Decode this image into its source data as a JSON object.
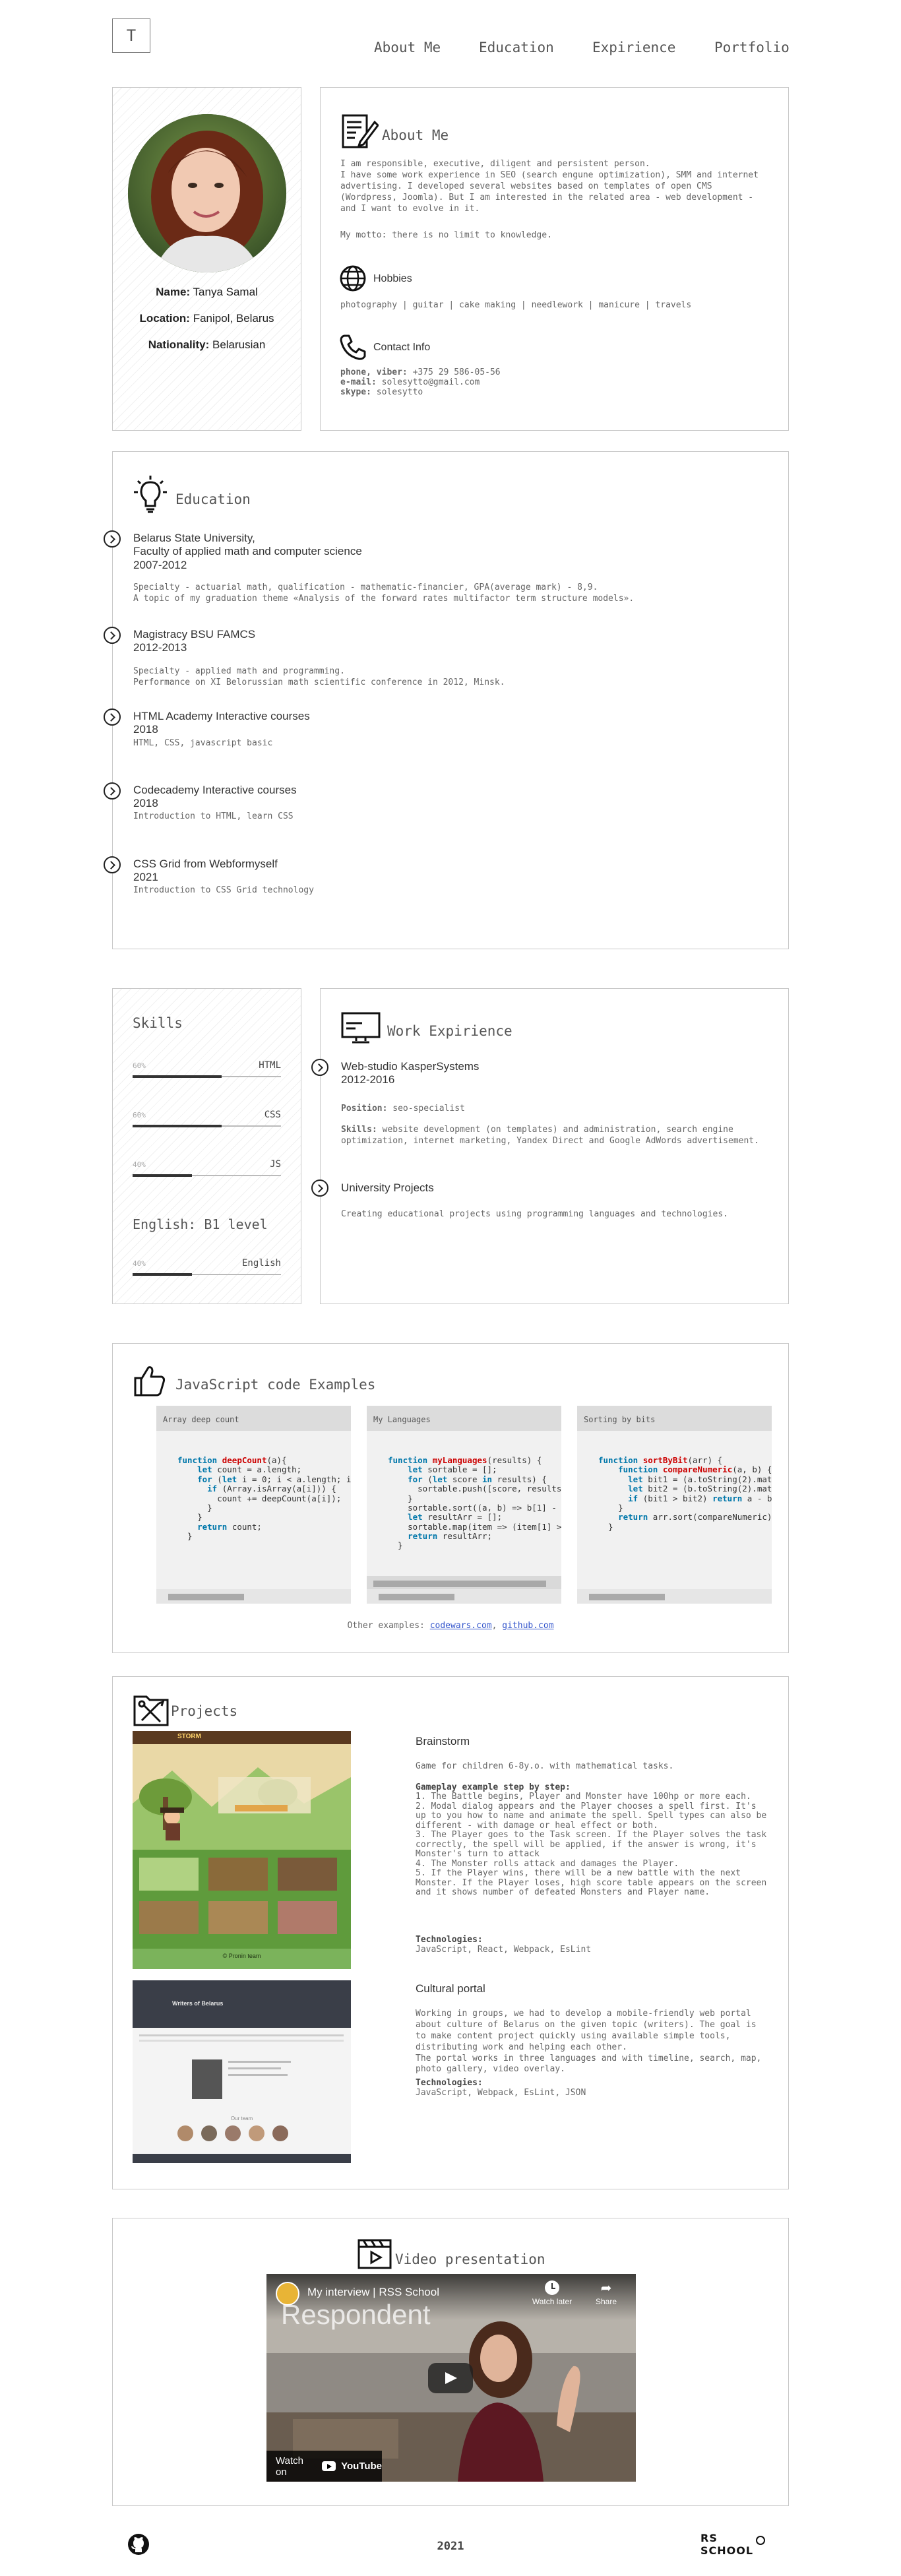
{
  "header": {
    "logo_letter": "T",
    "nav": [
      "About Me",
      "Education",
      "Expirience",
      "Portfolio"
    ]
  },
  "profile": {
    "photo_alt": "Tanya Samal portrait",
    "name_label": "Name:",
    "name_value": "Tanya Samal",
    "location_label": "Location:",
    "location_value": "Fanipol, Belarus",
    "nationality_label": "Nationality:",
    "nationality_value": "Belarusian"
  },
  "about": {
    "title": "About Me",
    "text": "I am responsible, executive, diligent and persistent person.\nI have some work experience in SEO (search engune optimization), SMM and internet advertising. I developed several websites based on templates of open CMS (Wordpress, Joomla). But I am interested in the related area - web development - and I want to evolve in it.",
    "motto": "My motto: there is no limit to knowledge.",
    "hobbies_title": "Hobbies",
    "hobbies": "photography | guitar | cake making | needlework | manicure | travels",
    "contact_title": "Contact Info",
    "phone_label": "phone, viber:",
    "phone_value": "+375 29 586-05-56",
    "email_label": "e-mail:",
    "email_value": "solesytto@gmail.com",
    "skype_label": "skype:",
    "skype_value": "solesytto"
  },
  "education": {
    "title": "Education",
    "items": [
      {
        "heading": "Belarus State University,\nFaculty of applied math and computer science\n2007-2012",
        "text": "Specialty - actuarial math, qualification - mathematic-financier, GPA(average mark) - 8,9.\nA topic of my graduation theme «Analysis of the forward rates multifactor term structure models»."
      },
      {
        "heading": "Magistracy BSU FAMCS\n2012-2013",
        "text": "Specialty - applied math and programming.\nPerformance on XI Belorussian math scientific conference in 2012, Minsk."
      },
      {
        "heading": "HTML Academy Interactive courses\n2018",
        "text": "HTML, CSS, javascript basic"
      },
      {
        "heading": "Codecademy Interactive courses\n2018",
        "text": "Introduction to HTML, learn CSS"
      },
      {
        "heading": "CSS Grid from Webformyself\n2021",
        "text": "Introduction to CSS Grid technology"
      }
    ]
  },
  "skills": {
    "title": "Skills",
    "items": [
      {
        "pct_label": "60%",
        "name": "HTML",
        "level": 0.6
      },
      {
        "pct_label": "60%",
        "name": "CSS",
        "level": 0.6
      },
      {
        "pct_label": "40%",
        "name": "JS",
        "level": 0.4
      }
    ],
    "english_title": "English: B1 level",
    "english": {
      "pct_label": "40%",
      "name": "English",
      "level": 0.4
    }
  },
  "work": {
    "title": "Work Expirience",
    "items": [
      {
        "heading": "Web-studio KasperSystems\n2012-2016",
        "position_label": "Position:",
        "position": "seo-specialist",
        "skills_label": "Skills:",
        "skills": "website development (on templates) and administration, search engine optimization, internet marketing, Yandex Direct and Google AdWords advertisement."
      },
      {
        "heading": "University Projects",
        "text": "Creating educational projects using programming languages and technologies."
      }
    ]
  },
  "code": {
    "title": "JavaScript code Examples",
    "cards": [
      {
        "title": "Array deep count"
      },
      {
        "title": "My Languages"
      },
      {
        "title": "Sorting by bits"
      }
    ],
    "other_label": "Other examples:",
    "link1": "codewars.com",
    "link2": "github.com"
  },
  "projects": {
    "title": "Projects",
    "items": [
      {
        "name": "Brainstorm",
        "intro": "Game for children 6-8y.o. with mathematical tasks.",
        "steps_title": "Gameplay example step by step:",
        "steps": "1. The Battle begins, Player and Monster have 100hp or more each.\n2. Modal dialog appears and the Player chooses a spell first. It's up to you how to name and animate the spell. Spell types can also be different - with damage or heal effect or both.\n3. The Player goes to the Task screen. If the Player solves the task correctly, the spell will be applied, if the answer is wrong, it's Monster's turn to attack\n4. The Monster rolls attack and damages the Player.\n5. If the Player wins, there will be a new battle with the next Monster. If the Player loses, high score table appears on the screen and it shows number of defeated Monsters and Player name.",
        "tech_title": "Technologies:",
        "tech": "JavaScript, React, Webpack, EsLint",
        "shot_brand": "STORM",
        "shot_footer": "© Pronin team"
      },
      {
        "name": "Cultural portal",
        "intro": "Working in groups, we had to develop a mobile-friendly web portal about culture of Belarus on the given topic (writers). The goal is to make content project quickly using available simple tools, distributing work and helping each other.\nThe portal works in three languages and with timeline, search, map, photo gallery, video overlay.",
        "tech_title": "Technologies:",
        "tech": "JavaScript, Webpack, EsLint, JSON",
        "shot_title": "Writers of Belarus",
        "shot_team": "Our team"
      }
    ]
  },
  "video": {
    "title": "Video presentation",
    "video_title": "My interview | RSS School",
    "overlay_word": "Respondent",
    "watch_later": "Watch later",
    "share": "Share",
    "watch_on": "Watch on",
    "youtube": "YouTube"
  },
  "footer": {
    "year": "2021",
    "rs_logo": "RS SCHOOL"
  },
  "colors": {
    "border": "#c8c8c8",
    "text": "#444444",
    "link": "#3355cc",
    "game_green": "#7bb35b"
  }
}
